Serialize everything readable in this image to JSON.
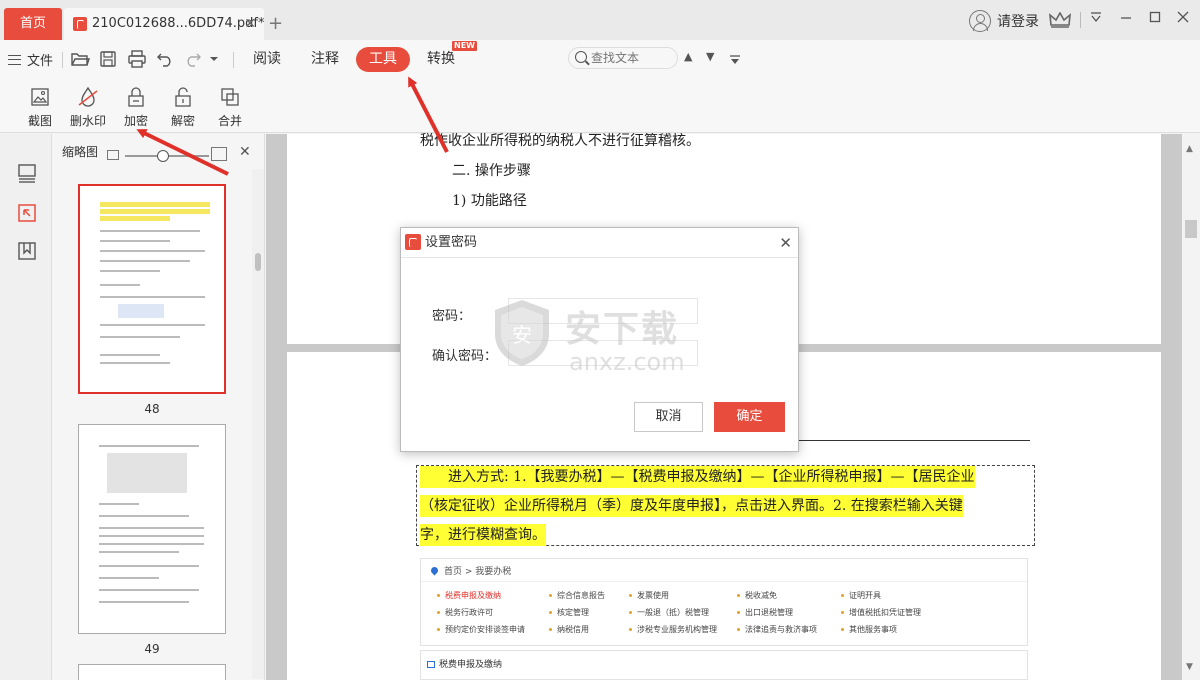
{
  "tabs": {
    "home_label": "首页",
    "doc_title": "210C012688...6DD74.pdf*",
    "close_glyph": "✕",
    "add_glyph": "+"
  },
  "account": {
    "login_label": "请登录"
  },
  "menu": {
    "file_label": "文件",
    "read_label": "阅读",
    "annotate_label": "注释",
    "tools_label": "工具",
    "convert_label": "转换",
    "new_badge": "NEW",
    "search_placeholder": "查找文本"
  },
  "ribbon": {
    "tools": [
      {
        "label": "截图",
        "icon": "screenshot-icon"
      },
      {
        "label": "删水印",
        "icon": "remove-watermark-icon"
      },
      {
        "label": "加密",
        "icon": "lock-icon"
      },
      {
        "label": "解密",
        "icon": "unlock-icon"
      },
      {
        "label": "合并",
        "icon": "merge-icon"
      }
    ]
  },
  "thumbnails": {
    "title": "缩略图",
    "pages": [
      {
        "number": "48",
        "selected": true
      },
      {
        "number": "49",
        "selected": false
      }
    ]
  },
  "document": {
    "page1_lines": [
      "税作收企业所得税的纳税人不进行征算稽核。",
      "二.  操作步骤",
      "1)    功能路径"
    ],
    "highlight_lines": [
      "进入方式: 1.【我要办税】—【税费申报及缴纳】—【企业所得税申报】—【居民企业",
      "（核定征收）企业所得税月（季）度及年度申报】，点击进入界面。2. 在搜索栏输入关键",
      "字，进行模糊查询。"
    ],
    "web_breadcrumb": "首页 > 我要办税",
    "web_links": [
      [
        "税费申报及缴纳",
        "综合信息报告",
        "发票使用",
        "税收减免",
        "证明开具"
      ],
      [
        "税务行政许可",
        "核定管理",
        "一般退（抵）税管理",
        "出口退税管理",
        "增值税抵扣凭证管理"
      ],
      [
        "预约定价安排谈签申请",
        "纳税信用",
        "涉税专业服务机构管理",
        "法律追责与救济事项",
        "其他服务事项"
      ]
    ],
    "web_section_title": "税费申报及缴纳"
  },
  "dialog": {
    "title": "设置密码",
    "password_label": "密码：",
    "confirm_label": "确认密码：",
    "cancel_label": "取消",
    "ok_label": "确定",
    "close_glyph": "✕"
  },
  "watermark": {
    "cn": "安下载",
    "en": "anxz.com"
  },
  "colors": {
    "accent": "#e84c3d",
    "highlight": "#ffff33"
  }
}
